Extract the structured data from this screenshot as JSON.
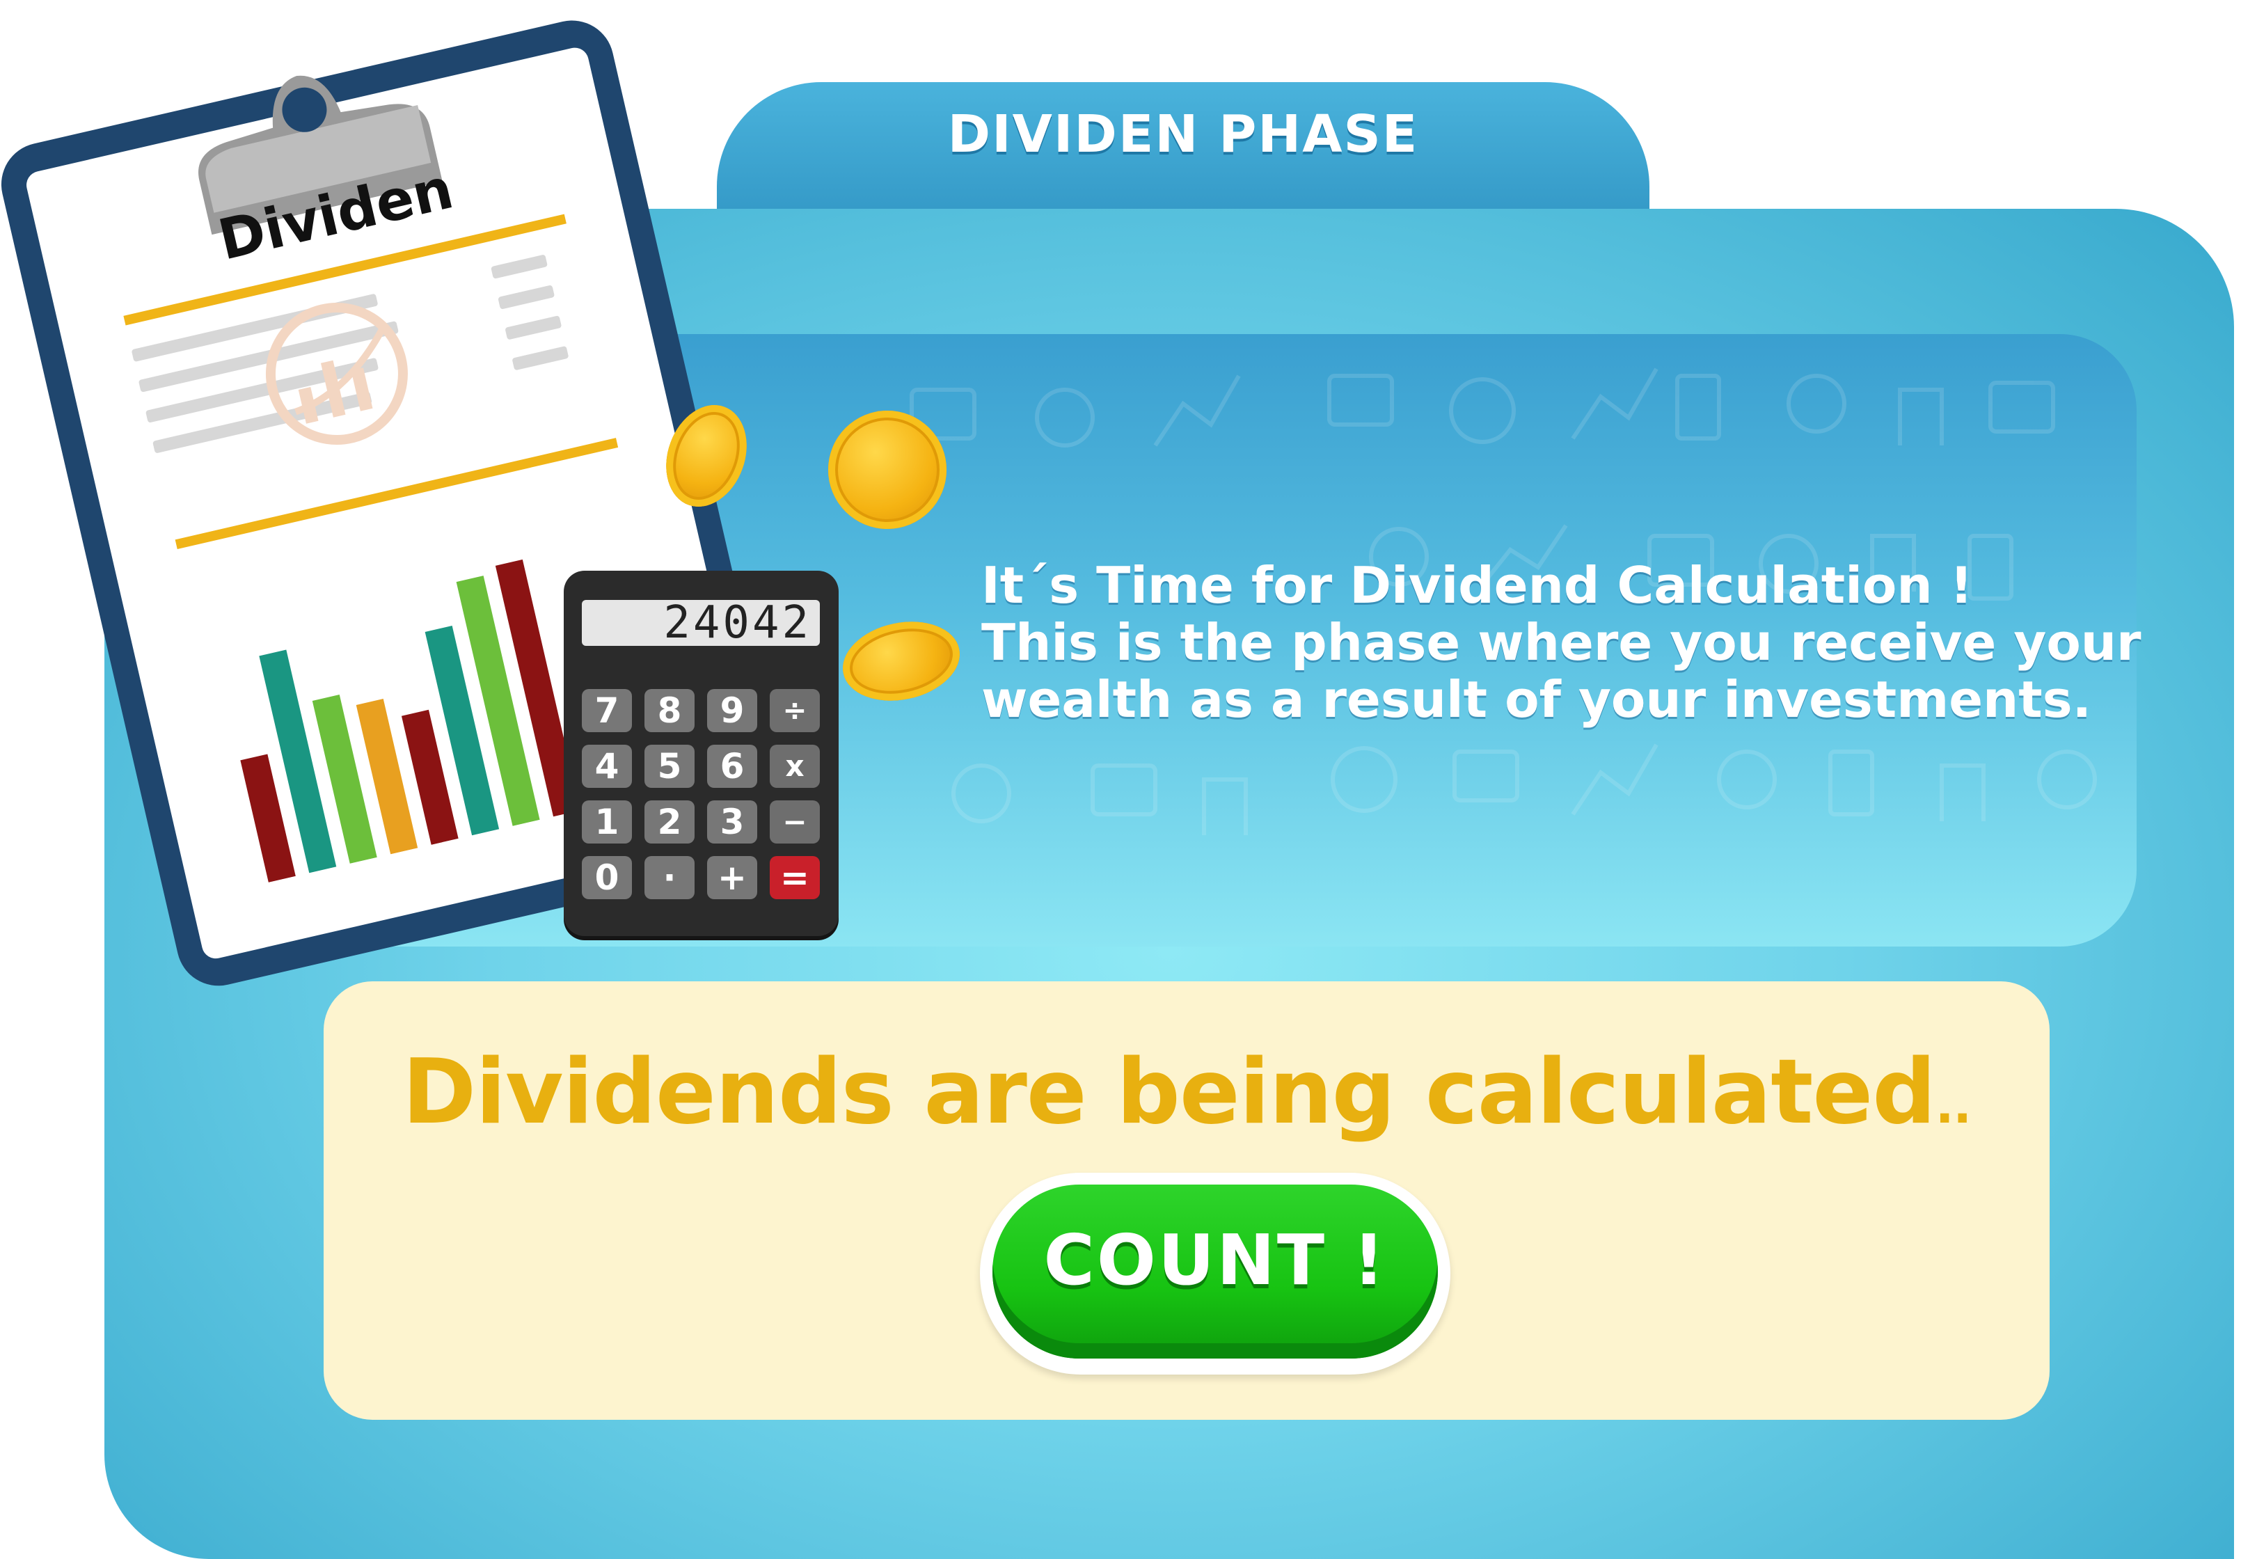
{
  "header": {
    "title": "DIVIDEN PHASE"
  },
  "clipboard": {
    "title": "Dividen"
  },
  "calculator": {
    "display": "24042",
    "keys": [
      "7",
      "8",
      "9",
      "÷",
      "4",
      "5",
      "6",
      "x",
      "1",
      "2",
      "3",
      "−",
      "0",
      "·",
      "+",
      "="
    ]
  },
  "message": {
    "line1": "It´s Time for Dividend Calculation !",
    "line2": "This is the phase where you receive your",
    "line3": "wealth as a result of your investments."
  },
  "status": {
    "text": "Dividends are being calculated",
    "dots": ".."
  },
  "count_button": {
    "label": "COUNT !"
  },
  "colors": {
    "panel": "#6fd3ea",
    "accent_yellow": "#e8b010",
    "button_green": "#17c312",
    "cream": "#fdf4cf"
  }
}
